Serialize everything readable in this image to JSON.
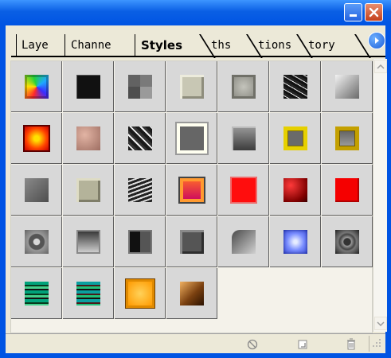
{
  "panel": {
    "tabs": [
      {
        "label": "Laye",
        "active": false
      },
      {
        "label": "Channe",
        "active": false
      },
      {
        "label": "Styles",
        "active": true
      },
      {
        "label": "ths",
        "active": false
      },
      {
        "label": "tions",
        "active": false
      },
      {
        "label": "tory",
        "active": false
      }
    ],
    "styles_grid": {
      "columns": 7,
      "rows": 5,
      "swatches": [
        "rainbow-bevel",
        "black-square",
        "gray-pyramid",
        "beige-bevel",
        "gray-pillow",
        "black-cracked-texture",
        "gray-gradient-bevel",
        "red-yellow-glow",
        "rose-matte",
        "black-white-marble",
        "gray-outline-selected",
        "gray-cube",
        "yellow-frame-bevel",
        "gold-frame",
        "gray-soft-bevel",
        "khaki-bevel",
        "wavy-stripes",
        "red-orange-gradient-frame",
        "red-dotted",
        "dark-red-glow",
        "red-flat",
        "gray-circle-button",
        "gray-window",
        "dark-split-bevel",
        "gray-raised",
        "gray-rounded-corner",
        "blue-star-glow",
        "dark-ring",
        "green-stripe-rainbow",
        "teal-stripe-rainbow",
        "gold-orange-bevel",
        "wood-bronze"
      ]
    },
    "colors": {
      "title_blue": "#0054e3",
      "cell_bg": "#d8d8d8",
      "grid_line": "#5e5e5e",
      "panel_bg": "#ece9d8"
    },
    "status_icons": [
      "clear-style-icon",
      "new-style-icon",
      "delete-style-icon"
    ]
  }
}
